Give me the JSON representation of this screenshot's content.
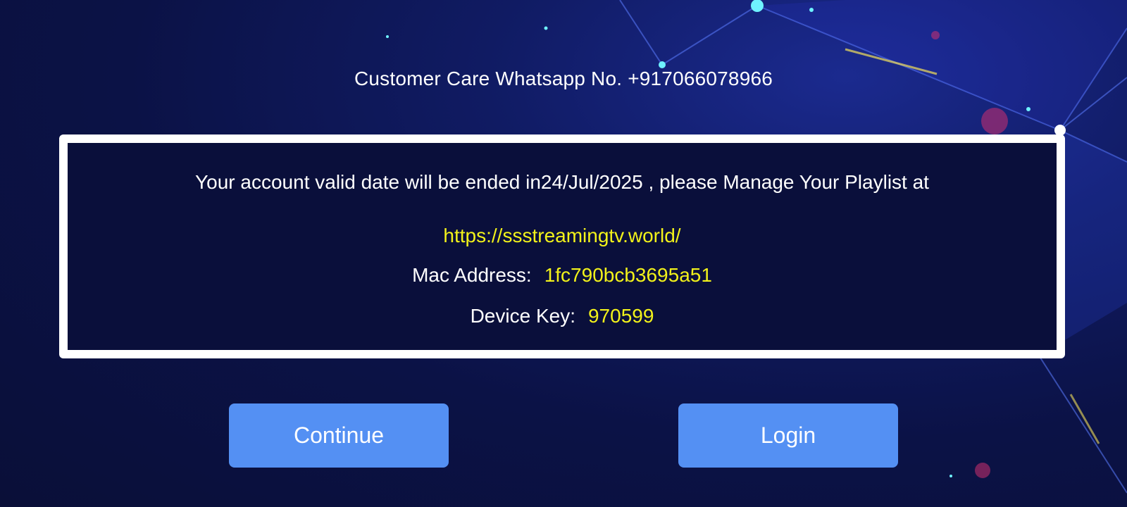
{
  "header": {
    "support_text": "Customer Care Whatsapp No. +917066078966"
  },
  "account_panel": {
    "message": "Your account valid date will be ended in24/Jul/2025 , please Manage Your Playlist at",
    "url": "https://ssstreamingtv.world/",
    "mac_label": "Mac Address:",
    "mac_value": "1fc790bcb3695a51",
    "key_label": "Device Key:",
    "key_value": "970599"
  },
  "actions": {
    "continue_label": "Continue",
    "login_label": "Login"
  },
  "colors": {
    "background": "#0b1246",
    "panel_border": "#ffffff",
    "highlight_text": "#f2f21a",
    "button": "#5490f3"
  }
}
